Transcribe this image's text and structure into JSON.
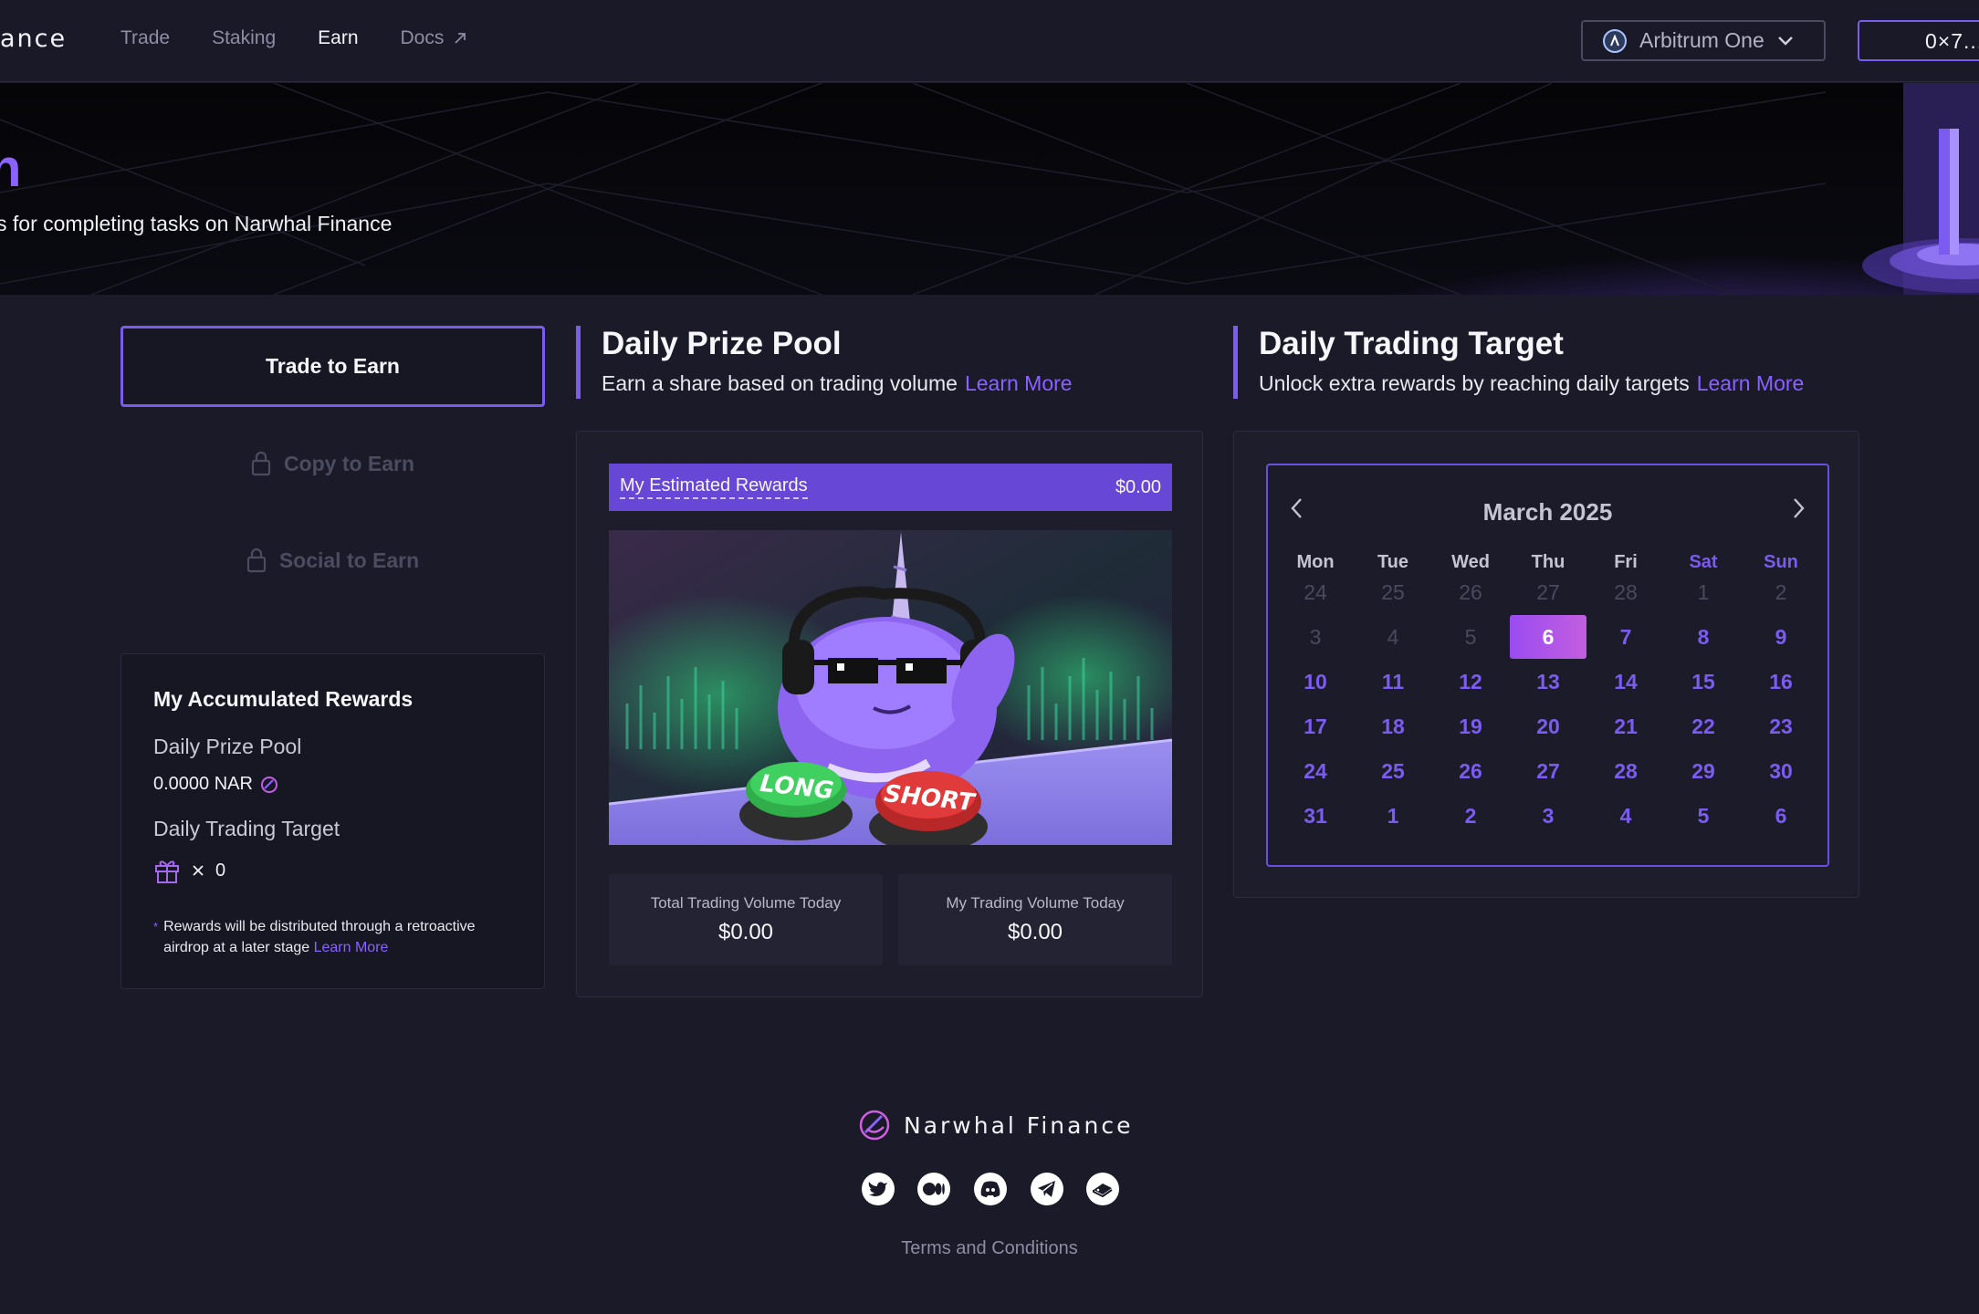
{
  "nav": {
    "brand": "ance",
    "links": [
      "Trade",
      "Staking",
      "Earn",
      "Docs"
    ],
    "active": "Earn",
    "network": "Arbitrum One",
    "wallet": "0×7..."
  },
  "hero": {
    "title": "n",
    "subtitle": "s for completing tasks on Narwhal Finance"
  },
  "tabs": {
    "trade": "Trade to Earn",
    "copy": "Copy to Earn",
    "social": "Social to Earn"
  },
  "rewards": {
    "title": "My Accumulated Rewards",
    "prize_label": "Daily Prize Pool",
    "prize_value": "0.0000 NAR",
    "target_label": "Daily Trading Target",
    "target_value": "0",
    "note": "Rewards will be distributed through a retroactive airdrop at a later stage",
    "note_link": "Learn More"
  },
  "prize_pool": {
    "title": "Daily Prize Pool",
    "subtitle": "Earn a share based on trading volume",
    "link": "Learn More",
    "estimated_label": "My Estimated Rewards",
    "estimated_value": "$0.00",
    "btn_long": "LONG",
    "btn_short": "SHORT",
    "total_volume_label": "Total Trading Volume Today",
    "total_volume_value": "$0.00",
    "my_volume_label": "My Trading Volume Today",
    "my_volume_value": "$0.00"
  },
  "target": {
    "title": "Daily Trading Target",
    "subtitle": "Unlock extra rewards by reaching daily targets",
    "link": "Learn More"
  },
  "calendar": {
    "month": "March 2025",
    "weekdays": [
      "Mon",
      "Tue",
      "Wed",
      "Thu",
      "Fri",
      "Sat",
      "Sun"
    ],
    "weeks": [
      [
        "24",
        "25",
        "26",
        "27",
        "28",
        "1",
        "2"
      ],
      [
        "3",
        "4",
        "5",
        "6",
        "7",
        "8",
        "9"
      ],
      [
        "10",
        "11",
        "12",
        "13",
        "14",
        "15",
        "16"
      ],
      [
        "17",
        "18",
        "19",
        "20",
        "21",
        "22",
        "23"
      ],
      [
        "24",
        "25",
        "26",
        "27",
        "28",
        "29",
        "30"
      ],
      [
        "31",
        "1",
        "2",
        "3",
        "4",
        "5",
        "6"
      ]
    ],
    "today": "6"
  },
  "footer": {
    "brand": "Narwhal Finance",
    "socials": [
      "twitter-icon",
      "medium-icon",
      "discord-icon",
      "telegram-icon",
      "gitbook-icon"
    ],
    "terms": "Terms and Conditions"
  },
  "colors": {
    "accent": "#7c5cf0",
    "background": "#1a1a28",
    "card": "#1d1d2c"
  }
}
